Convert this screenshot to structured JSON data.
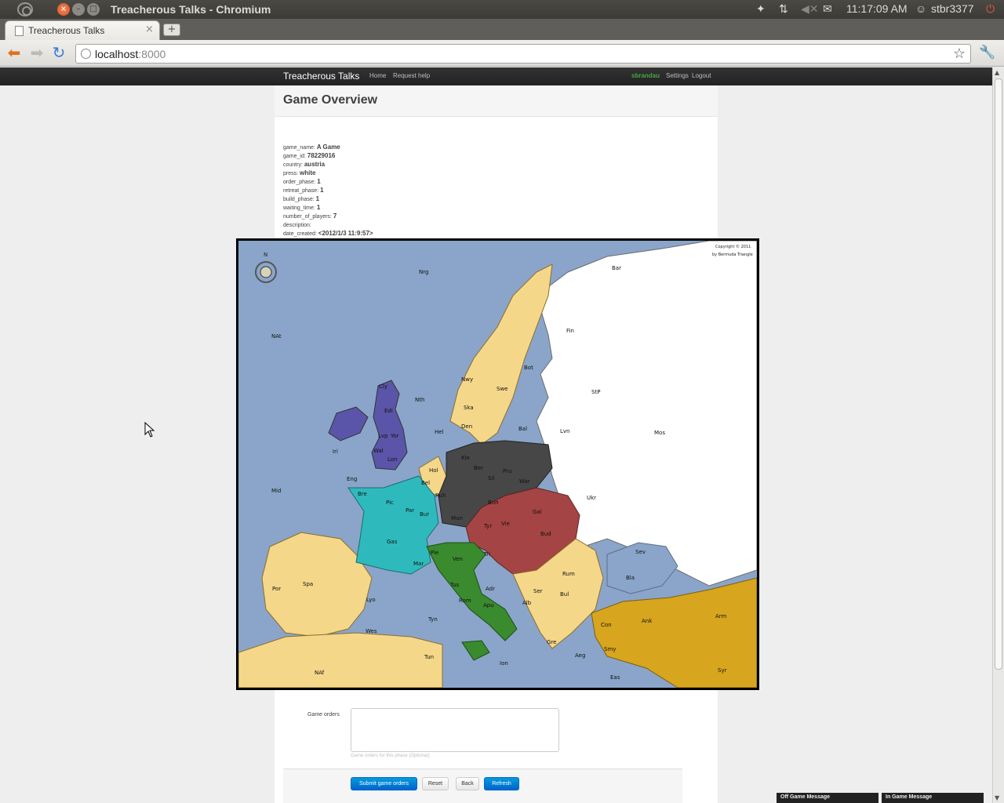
{
  "window": {
    "title": "Treacherous Talks - Chromium"
  },
  "tray": {
    "time": "11:17:09 AM",
    "user": "stbr3377"
  },
  "browser": {
    "tab_title": "Treacherous Talks",
    "url_host": "localhost",
    "url_port": ":8000"
  },
  "nav": {
    "brand": "Treacherous Talks",
    "home": "Home",
    "help": "Request help",
    "user": "sbrandau",
    "settings": "Settings",
    "logout": "Logout"
  },
  "page": {
    "title": "Game Overview"
  },
  "game": {
    "fields": [
      {
        "key": "game_name:",
        "value": "A Game"
      },
      {
        "key": "game_id:",
        "value": "78229016"
      },
      {
        "key": "country:",
        "value": "austria"
      },
      {
        "key": "press:",
        "value": "white"
      },
      {
        "key": "order_phase:",
        "value": "1"
      },
      {
        "key": "retreat_phase:",
        "value": "1"
      },
      {
        "key": "build_phase:",
        "value": "1"
      },
      {
        "key": "waiting_time:",
        "value": "1"
      },
      {
        "key": "number_of_players:",
        "value": "7"
      },
      {
        "key": "description:",
        "value": ""
      },
      {
        "key": "date_created:",
        "value": "<2012/1/3 11:9:57>"
      }
    ]
  },
  "map": {
    "copyright": "Copyright © 2011",
    "copyright2": "by Bermuda Triangle",
    "labels": [
      "Nrg",
      "Bar",
      "NAt",
      "Fin",
      "Nwy",
      "Swe",
      "Bot",
      "Nth",
      "Ska",
      "Hel",
      "Den",
      "Bal",
      "Lvn",
      "Mos",
      "StP",
      "Cly",
      "Edi",
      "Lvp",
      "Yor",
      "Wal",
      "Lon",
      "Iri",
      "Eng",
      "Hol",
      "Bel",
      "Kie",
      "Ber",
      "Pru",
      "Sil",
      "War",
      "Ruh",
      "Mun",
      "Boh",
      "Gal",
      "Ukr",
      "Bre",
      "Pic",
      "Par",
      "Bur",
      "Gas",
      "Mar",
      "Tyr",
      "Vie",
      "Bud",
      "Sev",
      "Pie",
      "Ven",
      "Tri",
      "Rum",
      "Bla",
      "Mid",
      "Spa",
      "Por",
      "Lyo",
      "Tus",
      "Rom",
      "Apu",
      "Adr",
      "Ser",
      "Bul",
      "Alb",
      "Con",
      "Ank",
      "Arm",
      "Smy",
      "Gre",
      "Wes",
      "Tyn",
      "Ion",
      "Aeg",
      "Eas",
      "Tun",
      "NAf",
      "Syr"
    ],
    "colors": {
      "sea": "#8aa5c9",
      "neutral": "#f5d78a",
      "england": "#5a55a8",
      "france": "#2ebabd",
      "germany": "#474747",
      "austria": "#a54444",
      "italy": "#3a8a2e",
      "russia": "#ffffff",
      "turkey": "#d7a51e"
    }
  },
  "orders": {
    "label": "Game orders",
    "help": "Game orders for this phase (Optional)"
  },
  "buttons": {
    "submit": "Submit game orders",
    "reset": "Reset",
    "back": "Back",
    "refresh": "Refresh"
  },
  "messages": {
    "off": "Off Game Message",
    "in": "In Game Message"
  }
}
